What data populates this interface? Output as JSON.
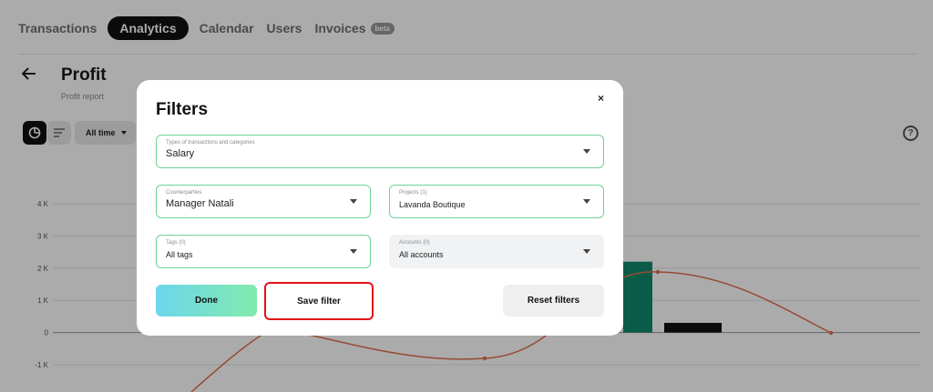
{
  "nav": {
    "tabs": [
      {
        "label": "Transactions"
      },
      {
        "label": "Analytics"
      },
      {
        "label": "Calendar"
      },
      {
        "label": "Users"
      },
      {
        "label": "Invoices",
        "badge": "beta"
      }
    ]
  },
  "page": {
    "back_icon": "arrow-left-icon",
    "title": "Profit",
    "subtitle": "Profit report",
    "period": "All time",
    "help_icon": "?"
  },
  "chart_data": {
    "type": "bar",
    "y_ticks": [
      "4 K",
      "3 K",
      "2 K",
      "1 K",
      "0",
      "-1 K"
    ],
    "ylim": [
      -1000,
      4000
    ],
    "bars": [
      {
        "value": 2200,
        "color": "#0f8a6c"
      },
      {
        "value": 300,
        "color": "#111111"
      }
    ],
    "line": {
      "color": "#e0714f",
      "points": [
        [
          300,
          360
        ],
        [
          532,
          394
        ],
        [
          722,
          299
        ],
        [
          912,
          366
        ]
      ]
    }
  },
  "modal": {
    "title": "Filters",
    "close_label": "×",
    "fields": {
      "types": {
        "label": "Types of transactions and categories",
        "value": "Salary"
      },
      "counterparties": {
        "label": "Counterparties",
        "value": "Manager Natali"
      },
      "projects": {
        "label": "Projects (1)",
        "value": "Lavanda Boutique"
      },
      "tags": {
        "label": "Tags (0)",
        "value": "All tags"
      },
      "accounts": {
        "label": "Accounts (0)",
        "value": "All accounts"
      }
    },
    "buttons": {
      "done": "Done",
      "save": "Save filter",
      "reset": "Reset filters"
    }
  },
  "colors": {
    "accent_green": "#6ed29a",
    "highlight_red": "#e4111a",
    "bar_green": "#0f8a6c"
  }
}
